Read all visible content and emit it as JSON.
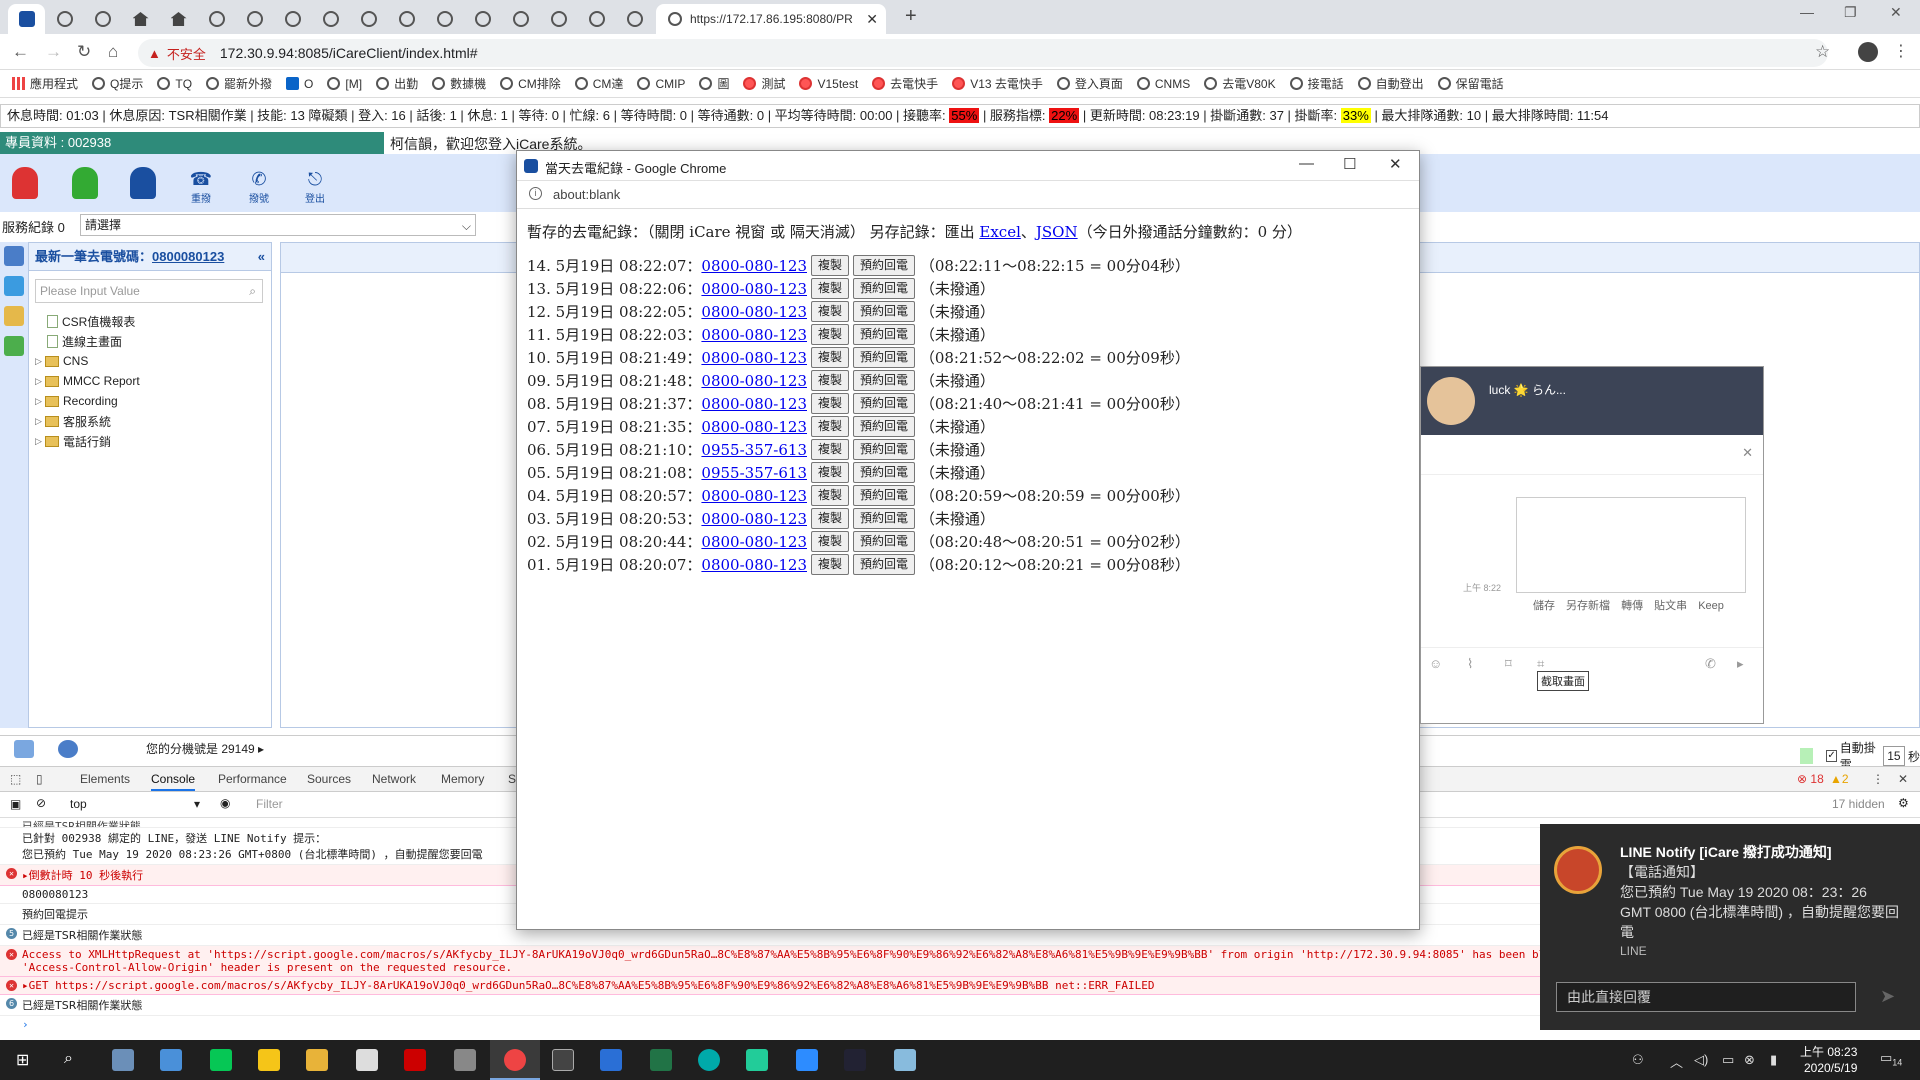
{
  "browser": {
    "active_tab_title": "https://172.17.86.195:8080/PR",
    "address_warning": "不安全",
    "address_url": "172.30.9.94:8085/iCareClient/index.html#",
    "bookmarks": [
      "應用程式",
      "Q提示",
      "TQ",
      "罷新外撥",
      "O",
      "[M]",
      "出勤",
      "數據機",
      "CM排除",
      "CM達",
      "CMIP",
      "圖",
      "測試",
      "V15test",
      "去電快手",
      "V13 去電快手",
      "登入頁面",
      "CNMS",
      "去電V80K",
      "接電話",
      "自動登出",
      "保留電話"
    ]
  },
  "status_strip": {
    "text1": "休息時間: 01:03 | 休息原因: TSR相關作業 | 技能: 13 障礙類 | 登入: 16 | 話後: 1 | 休息: 1 | 等待: 0 | 忙線: 6 | 等待時間: 0 | 等待通數: 0 | 平均等待時間: 00:00 | 接聽率:",
    "answer_rate": "55%",
    "text2": "| 服務指標:",
    "service_index": "22%",
    "text3": "| 更新時間: 08:23:19 | 掛斷通數: 37 | 掛斷率:",
    "hangup_rate": "33%",
    "text4": "| 最大排隊通數: 10 | 最大排隊時間: 11:54"
  },
  "app": {
    "agent_label": "專員資料 :   002938",
    "welcome": "柯信韻，歡迎您登入iCare系統。",
    "toolbar": [
      "重撥",
      "撥號",
      "登出"
    ],
    "service_record_label": "服務紀錄",
    "service_record_count": "0",
    "service_select": "請選擇",
    "last_call_label": "最新一筆去電號碼：",
    "last_call_number": "0800080123",
    "search_placeholder": "Please Input Value",
    "tree": [
      {
        "label": "CSR值機報表",
        "type": "doc"
      },
      {
        "label": "進線主畫面",
        "type": "doc"
      },
      {
        "label": "CNS",
        "type": "folder"
      },
      {
        "label": "MMCC Report",
        "type": "folder"
      },
      {
        "label": "Recording",
        "type": "folder"
      },
      {
        "label": "客服系統",
        "type": "folder"
      },
      {
        "label": "電話行銷",
        "type": "folder"
      }
    ],
    "extension_text": "您的分機號是 29149 ▸",
    "auto_hangup_label": "自動掛電",
    "auto_hangup_value": "15",
    "auto_hangup_unit": "秒"
  },
  "devtools": {
    "tabs": [
      "Elements",
      "Console",
      "Performance",
      "Sources",
      "Network",
      "Memory",
      "S"
    ],
    "context": "top",
    "filter_placeholder": "Filter",
    "hidden_count": "17 hidden",
    "errors": "18",
    "warnings": "2",
    "lines": [
      {
        "type": "info",
        "text": "已經是TSR相關作業狀態"
      },
      {
        "type": "log",
        "text": "已針對 002938 綁定的 LINE，發送 LINE Notify 提示：\n您已預約 Tue May 19 2020 08:23:26 GMT+0800 (台北標準時間) ，自動提醒您要回電"
      },
      {
        "type": "error",
        "text": "▸倒數計時 10 秒後執行"
      },
      {
        "type": "log",
        "text": "0800080123"
      },
      {
        "type": "log",
        "text": "預約回電提示"
      },
      {
        "type": "count",
        "count": "5",
        "text": "已經是TSR相關作業狀態"
      },
      {
        "type": "error",
        "text": "Access to XMLHttpRequest at 'https://script.google.com/macros/s/AKfycby_ILJY-8ArUKA19oVJ0q0_wrd6GDun5RaO…8C%E8%87%AA%E5%8B%95%E6%8F%90%E9%86%92%E6%82%A8%E8%A6%81%E5%9B%9E%E9%9B%BB' from origin 'http://172.30.9.94:8085' has been bl\n'Access-Control-Allow-Origin' header is present on the requested resource."
      },
      {
        "type": "error",
        "text": "▸GET https://script.google.com/macros/s/AKfycby_ILJY-8ArUKA19oVJ0q0_wrd6GDun5RaO…8C%E8%87%AA%E5%8B%95%E6%8F%90%E9%86%92%E6%82%A8%E8%A6%81%E5%9B%9E%E9%9B%BB net::ERR_FAILED"
      },
      {
        "type": "count",
        "count": "6",
        "text": "已經是TSR相關作業狀態"
      }
    ]
  },
  "popup": {
    "title": "當天去電紀錄 - Google Chrome",
    "address": "about:blank",
    "header_prefix": "暫存的去電紀錄：（關閉 iCare 視窗 或 隔天消滅） 另存記錄：匯出 ",
    "export_excel": "Excel",
    "sep": "、",
    "export_json": "JSON",
    "header_suffix": "（今日外撥通話分鐘數約：0 分）",
    "copy_label": "複製",
    "callback_label": "預約回電",
    "records": [
      {
        "idx": "14.",
        "time": "5月19日 08:22:07：",
        "number": "0800-080-123",
        "note": "（08:22:11～08:22:15 = 00分04秒）"
      },
      {
        "idx": "13.",
        "time": "5月19日 08:22:06：",
        "number": "0800-080-123",
        "note": "（未撥通）"
      },
      {
        "idx": "12.",
        "time": "5月19日 08:22:05：",
        "number": "0800-080-123",
        "note": "（未撥通）"
      },
      {
        "idx": "11.",
        "time": "5月19日 08:22:03：",
        "number": "0800-080-123",
        "note": "（未撥通）"
      },
      {
        "idx": "10.",
        "time": "5月19日 08:21:49：",
        "number": "0800-080-123",
        "note": "（08:21:52～08:22:02 = 00分09秒）"
      },
      {
        "idx": "09.",
        "time": "5月19日 08:21:48：",
        "number": "0800-080-123",
        "note": "（未撥通）"
      },
      {
        "idx": "08.",
        "time": "5月19日 08:21:37：",
        "number": "0800-080-123",
        "note": "（08:21:40～08:21:41 = 00分00秒）"
      },
      {
        "idx": "07.",
        "time": "5月19日 08:21:35：",
        "number": "0800-080-123",
        "note": "（未撥通）"
      },
      {
        "idx": "06.",
        "time": "5月19日 08:21:10：",
        "number": "0955-357-613",
        "note": "（未撥通）"
      },
      {
        "idx": "05.",
        "time": "5月19日 08:21:08：",
        "number": "0955-357-613",
        "note": "（未撥通）"
      },
      {
        "idx": "04.",
        "time": "5月19日 08:20:57：",
        "number": "0800-080-123",
        "note": "（08:20:59～08:20:59 = 00分00秒）"
      },
      {
        "idx": "03.",
        "time": "5月19日 08:20:53：",
        "number": "0800-080-123",
        "note": "（未撥通）"
      },
      {
        "idx": "02.",
        "time": "5月19日 08:20:44：",
        "number": "0800-080-123",
        "note": "（08:20:48～08:20:51 = 00分02秒）"
      },
      {
        "idx": "01.",
        "time": "5月19日 08:20:07：",
        "number": "0800-080-123",
        "note": "（08:20:12～08:20:21 = 00分08秒）"
      }
    ]
  },
  "line_chat": {
    "name": "luck 🌟 らん...",
    "timestamp": "上午 8:22",
    "actions": "儲存 另存新檔 轉傳 貼文串 Keep",
    "tooltip": "截取畫面"
  },
  "toast": {
    "title": "LINE Notify [iCare 撥打成功通知]",
    "subtitle": "【電話通知】",
    "body": "您已預約 Tue May 19 2020 08：23：26 GMT 0800 (台北標準時間) ，自動提醒您要回電",
    "app": "LINE",
    "reply_placeholder": "由此直接回覆"
  },
  "taskbar": {
    "time": "上午 08:23",
    "date": "2020/5/19",
    "notif_count": "14"
  },
  "colors": {
    "accent_teal": "#2e8b7a",
    "toolband": "#dbe7fb",
    "rate_red": "#e11111",
    "rate_yellow": "#ffff00"
  }
}
